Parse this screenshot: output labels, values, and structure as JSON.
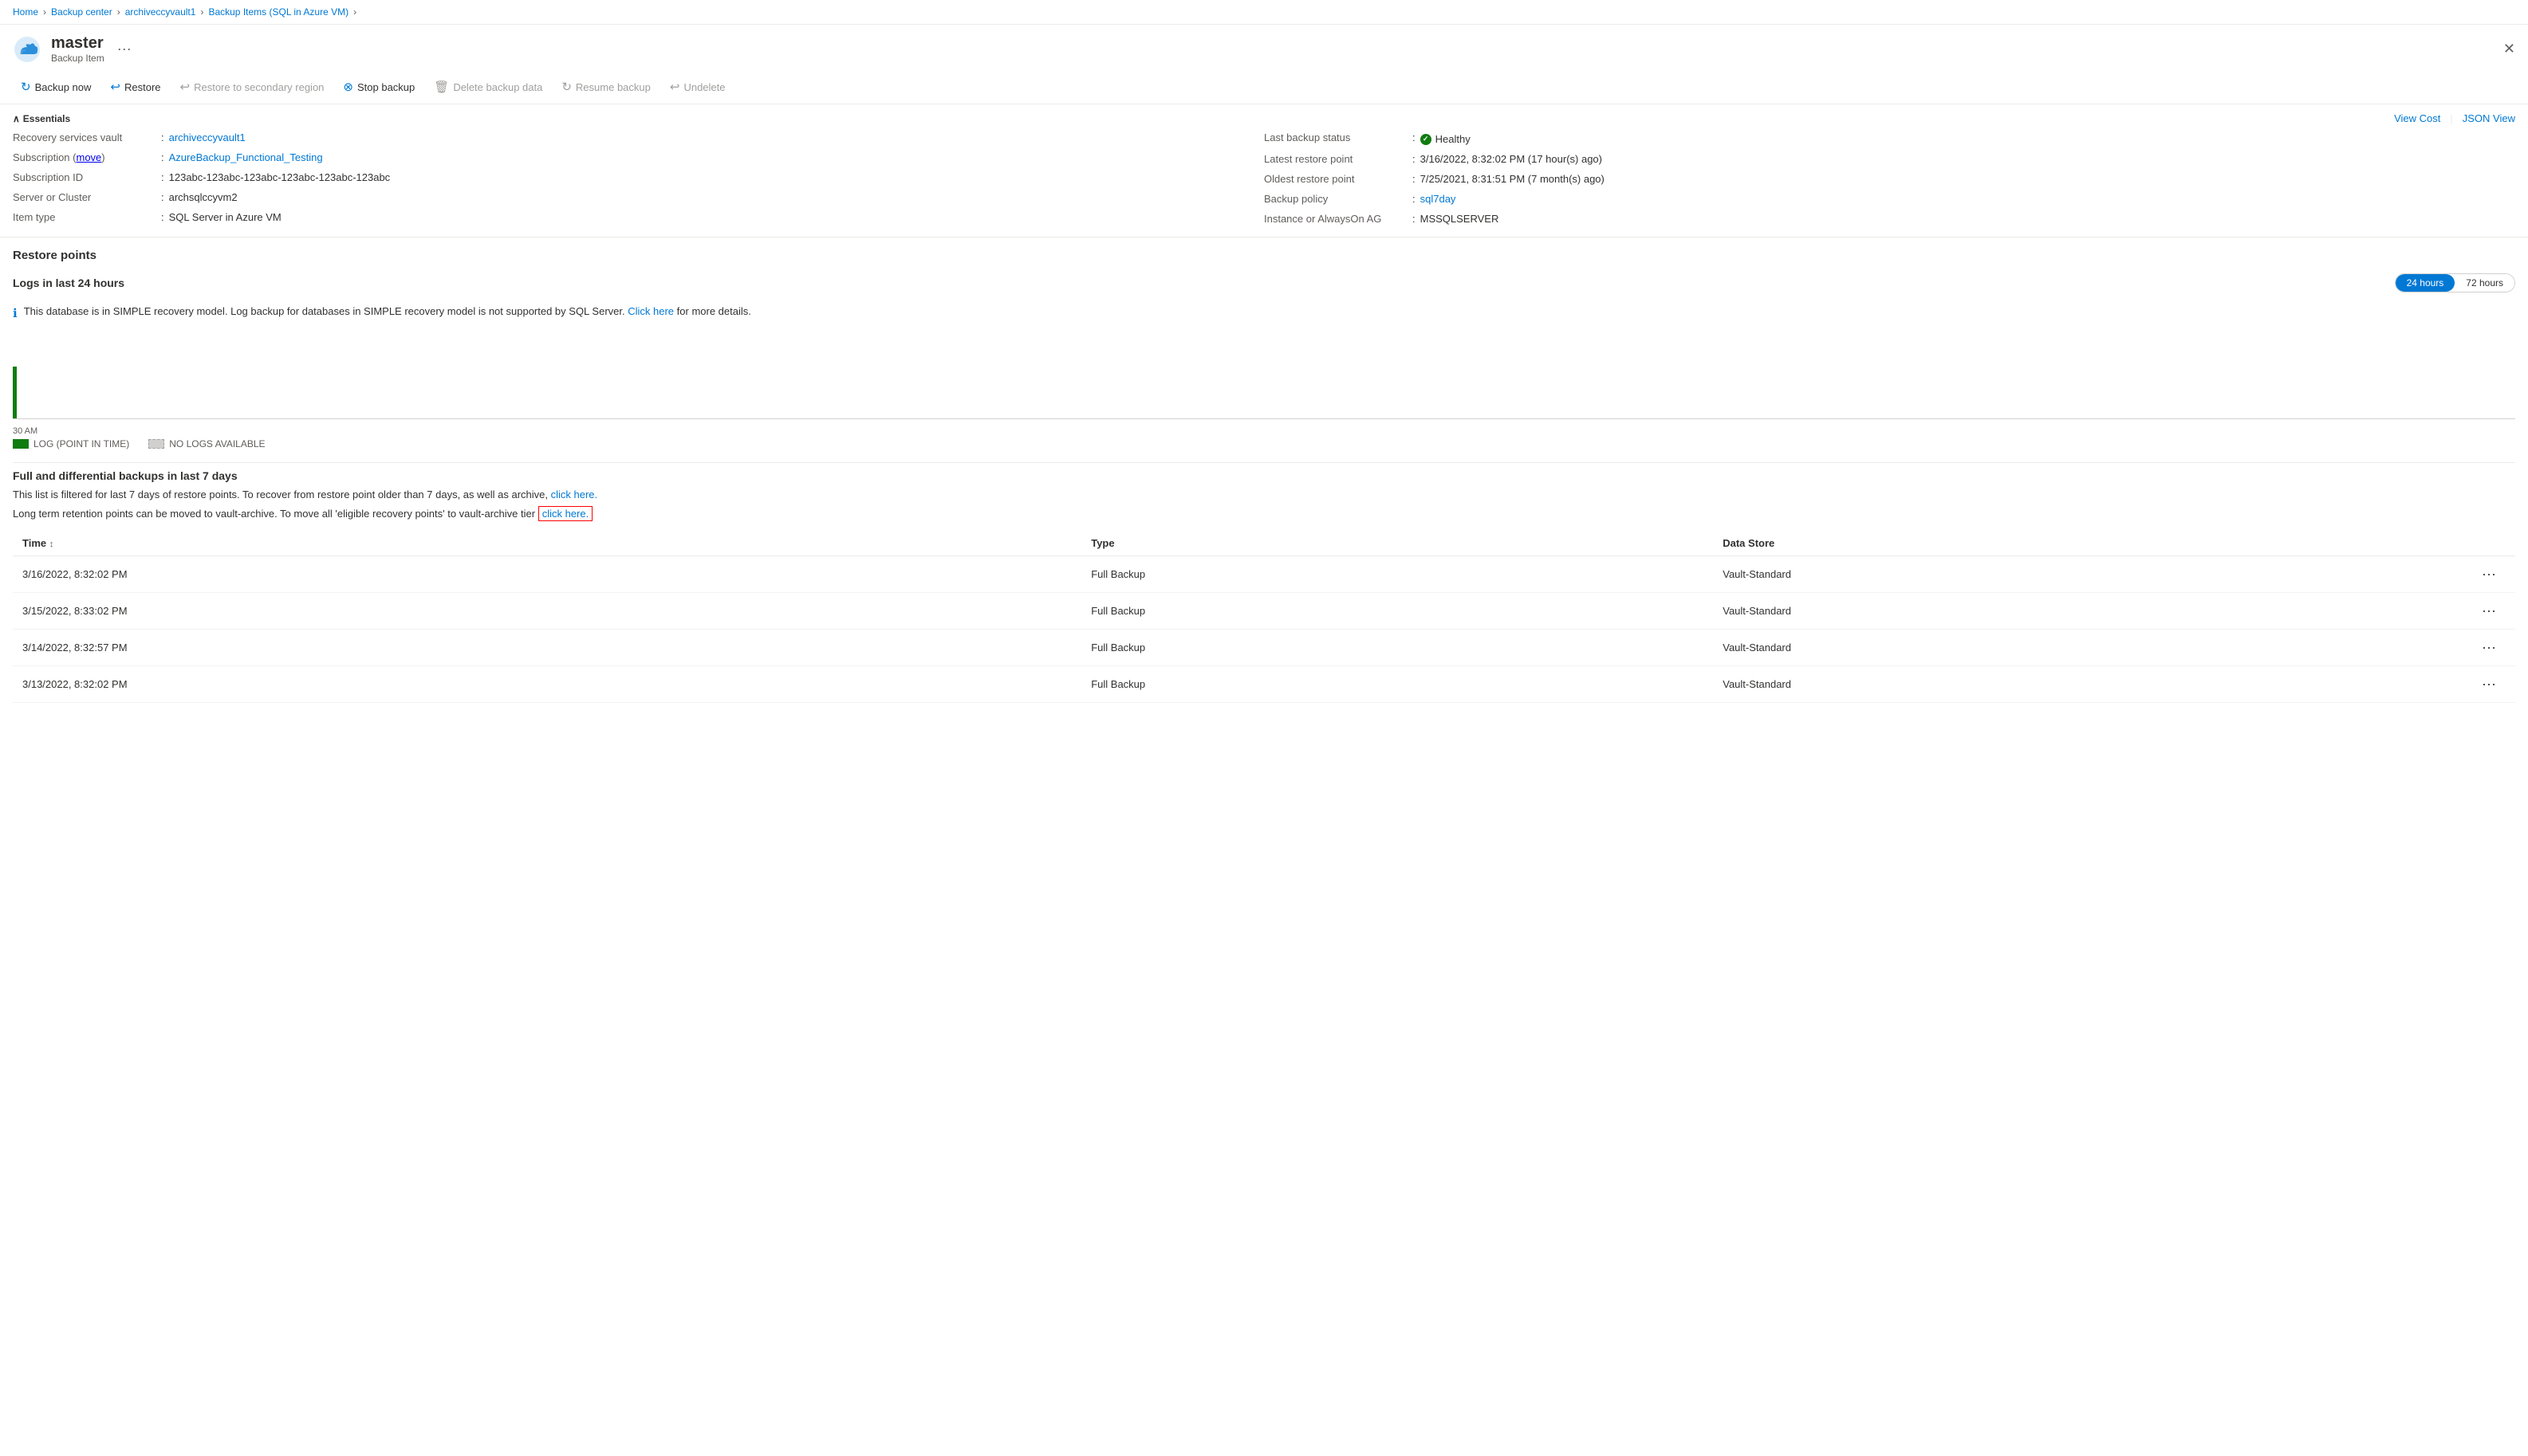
{
  "breadcrumb": {
    "items": [
      {
        "label": "Home",
        "link": true
      },
      {
        "label": "Backup center",
        "link": true
      },
      {
        "label": "archiveccyvault1",
        "link": true
      },
      {
        "label": "Backup Items (SQL in Azure VM)",
        "link": true
      }
    ]
  },
  "header": {
    "title": "master",
    "subtitle": "Backup Item",
    "dots_label": "···",
    "close_label": "✕"
  },
  "toolbar": {
    "buttons": [
      {
        "label": "Backup now",
        "icon": "↻",
        "disabled": false
      },
      {
        "label": "Restore",
        "icon": "↩",
        "disabled": false
      },
      {
        "label": "Restore to secondary region",
        "icon": "↩",
        "disabled": true
      },
      {
        "label": "Stop backup",
        "icon": "⊗",
        "disabled": false
      },
      {
        "label": "Delete backup data",
        "icon": "🗑",
        "disabled": true
      },
      {
        "label": "Resume backup",
        "icon": "↻",
        "disabled": true
      },
      {
        "label": "Undelete",
        "icon": "↩",
        "disabled": true
      }
    ]
  },
  "essentials": {
    "toggle_label": "Essentials",
    "view_cost_label": "View Cost",
    "json_view_label": "JSON View",
    "left": [
      {
        "label": "Recovery services vault",
        "value": "archiveccyvault1",
        "link": true
      },
      {
        "label": "Subscription",
        "value": "AzureBackup_Functional_Testing",
        "link": true,
        "move_label": "move"
      },
      {
        "label": "Subscription ID",
        "value": "123abc-123abc-123abc-123abc-123abc-123abc"
      },
      {
        "label": "Server or Cluster",
        "value": "archsqlccyvm2"
      },
      {
        "label": "Item type",
        "value": "SQL Server in Azure VM"
      }
    ],
    "right": [
      {
        "label": "Last backup status",
        "value": "Healthy",
        "is_status": true
      },
      {
        "label": "Latest restore point",
        "value": "3/16/2022, 8:32:02 PM (17 hour(s) ago)"
      },
      {
        "label": "Oldest restore point",
        "value": "7/25/2021, 8:31:51 PM (7 month(s) ago)"
      },
      {
        "label": "Backup policy",
        "value": "sql7day",
        "link": true
      },
      {
        "label": "Instance or AlwaysOn AG",
        "value": "MSSQLSERVER"
      }
    ]
  },
  "restore_points": {
    "title": "Restore points"
  },
  "logs": {
    "title": "Logs in last 24 hours",
    "toggle_24h": "24 hours",
    "toggle_72h": "72 hours",
    "info_text": "This database is in SIMPLE recovery model. Log backup for databases in SIMPLE recovery model is not supported by SQL Server.",
    "click_here_label": "Click here",
    "info_suffix": "for more details.",
    "chart_time_label": "30 AM",
    "legend": [
      {
        "label": "LOG (POINT IN TIME)",
        "type": "green"
      },
      {
        "label": "NO LOGS AVAILABLE",
        "type": "gray"
      }
    ]
  },
  "full_backups": {
    "title": "Full and differential backups in last 7 days",
    "desc1_prefix": "This list is filtered for last 7 days of restore points. To recover from restore point older than 7 days, as well as archive,",
    "desc1_link": "click here.",
    "desc2_prefix": "Long term retention points can be moved to vault-archive. To move all 'eligible recovery points' to vault-archive tier",
    "desc2_link": "click here.",
    "table": {
      "columns": [
        {
          "label": "Time",
          "sortable": true
        },
        {
          "label": "Type",
          "sortable": false
        },
        {
          "label": "Data Store",
          "sortable": false
        }
      ],
      "rows": [
        {
          "time": "3/16/2022, 8:32:02 PM",
          "type": "Full Backup",
          "data_store": "Vault-Standard"
        },
        {
          "time": "3/15/2022, 8:33:02 PM",
          "type": "Full Backup",
          "data_store": "Vault-Standard"
        },
        {
          "time": "3/14/2022, 8:32:57 PM",
          "type": "Full Backup",
          "data_store": "Vault-Standard"
        },
        {
          "time": "3/13/2022, 8:32:02 PM",
          "type": "Full Backup",
          "data_store": "Vault-Standard"
        }
      ]
    }
  }
}
